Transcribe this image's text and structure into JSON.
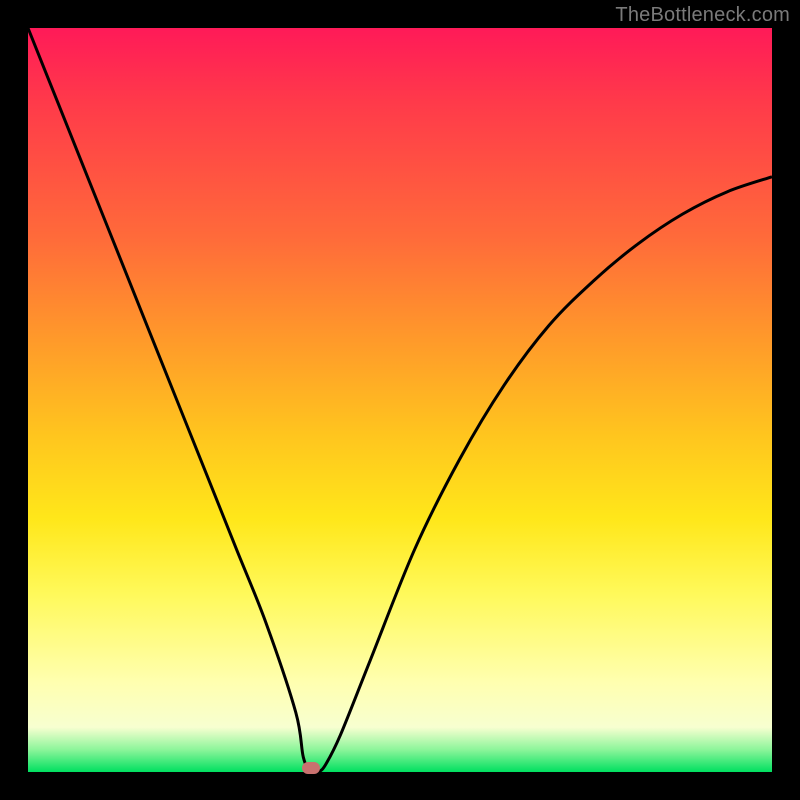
{
  "watermark": "TheBottleneck.com",
  "colors": {
    "frame": "#000000",
    "curve_stroke": "#000000",
    "marker_fill": "#c9716f",
    "gradient_stops": [
      "#ff1a58",
      "#ff3a4a",
      "#ff6a3a",
      "#ff9a2a",
      "#ffc61e",
      "#ffe71a",
      "#fff95a",
      "#ffffb0",
      "#f7ffd0",
      "#8cf59a",
      "#00e060"
    ]
  },
  "chart_data": {
    "type": "line",
    "title": "",
    "xlabel": "",
    "ylabel": "",
    "xlim": [
      0,
      100
    ],
    "ylim": [
      0,
      100
    ],
    "series": [
      {
        "name": "bottleneck-curve",
        "x": [
          0,
          4,
          8,
          12,
          16,
          20,
          24,
          28,
          32,
          36,
          37,
          38,
          39,
          40,
          42,
          46,
          52,
          58,
          64,
          70,
          76,
          82,
          88,
          94,
          100
        ],
        "values": [
          100,
          90,
          80,
          70,
          60,
          50,
          40,
          30,
          20,
          8,
          2,
          0,
          0,
          1,
          5,
          15,
          30,
          42,
          52,
          60,
          66,
          71,
          75,
          78,
          80
        ]
      }
    ],
    "marker": {
      "x": 38,
      "y": 0
    },
    "annotations": []
  }
}
